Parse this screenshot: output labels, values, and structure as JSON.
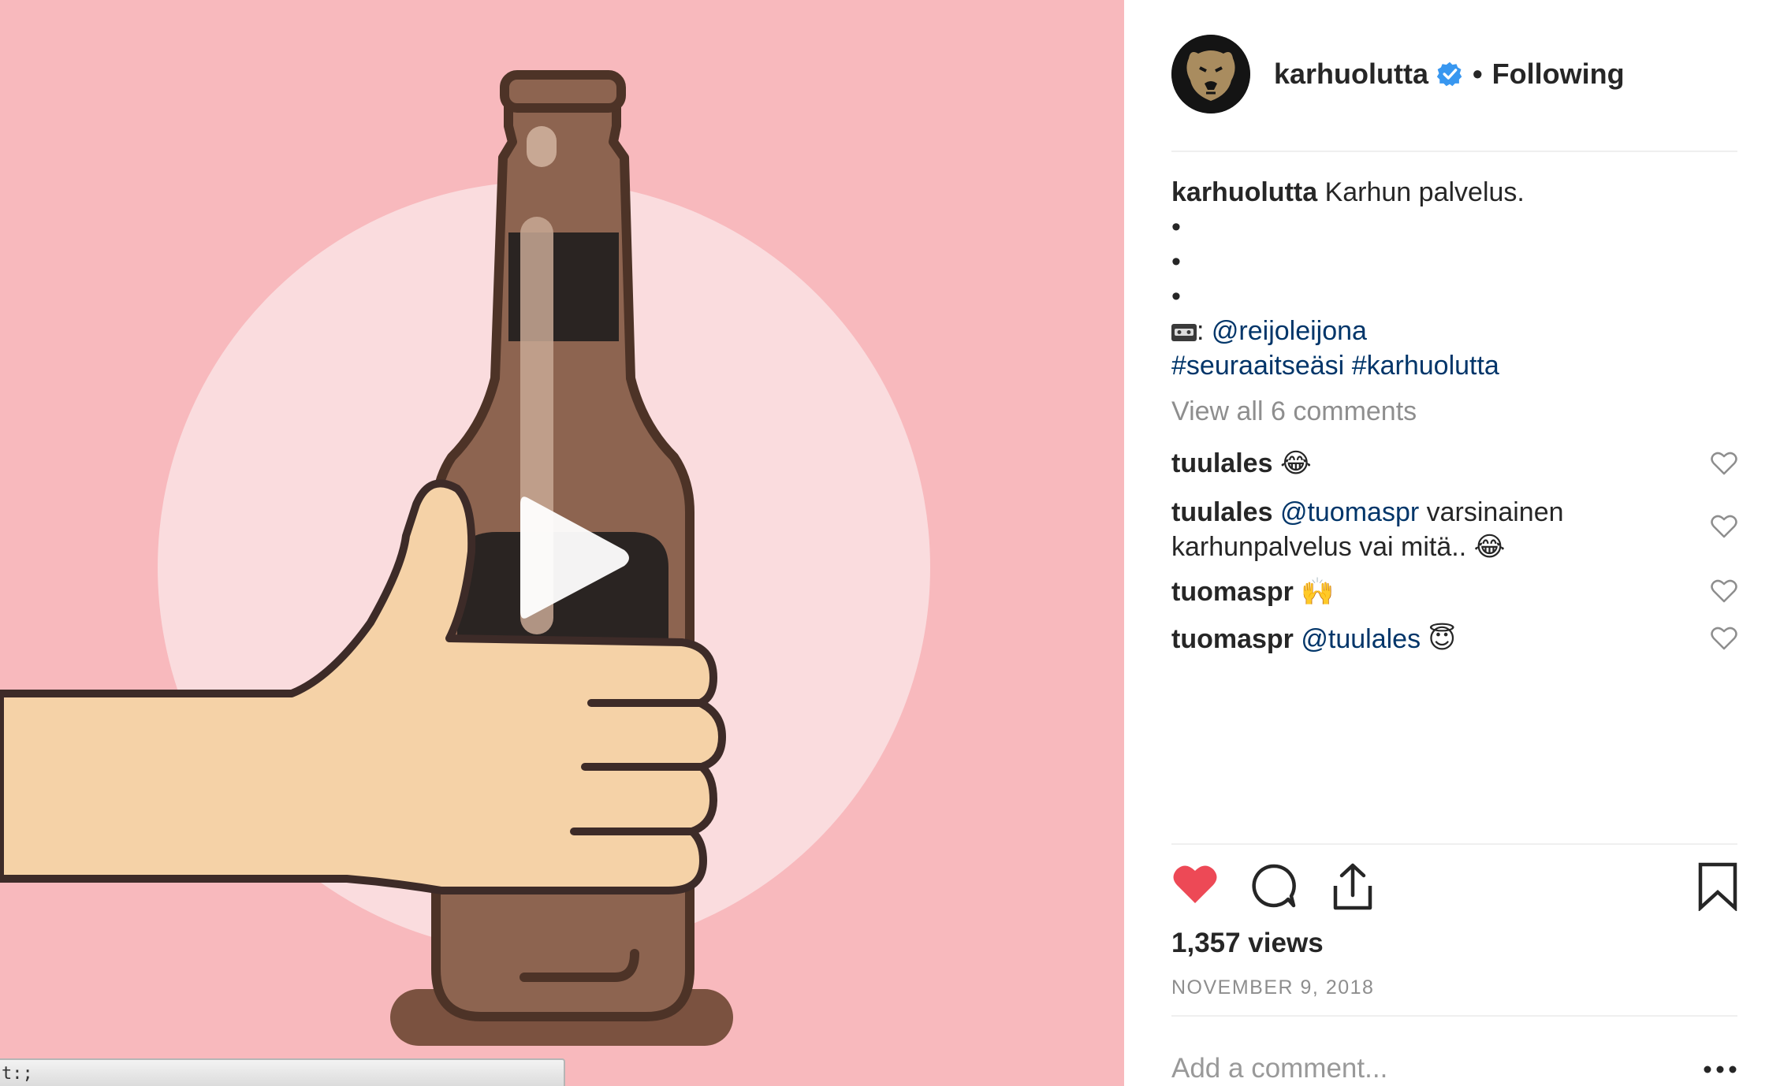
{
  "colors": {
    "media_background": "#f8b9bd",
    "link": "#003569",
    "like_red": "#ed4956",
    "verified_blue": "#3897f0",
    "muted_gray": "#8e8e8e"
  },
  "media": {
    "type": "video",
    "play_icon": "play-icon",
    "status_bar_text": "t:;"
  },
  "header": {
    "avatar_icon": "bear-logo-icon",
    "username": "karhuolutta",
    "verified_icon": "verified-badge-icon",
    "separator": "•",
    "follow_status": "Following"
  },
  "caption": {
    "username": "karhuolutta",
    "text": "Karhun palvelus.",
    "bullets": [
      "•",
      "•",
      "•"
    ],
    "credit_icon": "videotape-emoji",
    "credit_separator": ": ",
    "credit_mention": "@reijoleijona",
    "hashtags": [
      "#seuraaitseäsi",
      "#karhuolutta"
    ]
  },
  "view_all_comments": "View all 6 comments",
  "comments": [
    {
      "username": "tuulales",
      "mention": "",
      "text": "",
      "emoji": "😂",
      "heart_icon": "heart-outline-icon"
    },
    {
      "username": "tuulales",
      "mention": "@tuomaspr",
      "text": "varsinainen karhunpalvelus vai mitä..",
      "emoji": "😂",
      "heart_icon": "heart-outline-icon"
    },
    {
      "username": "tuomaspr",
      "mention": "",
      "text": "",
      "emoji": "🙌",
      "heart_icon": "heart-outline-icon"
    },
    {
      "username": "tuomaspr",
      "mention": "@tuulales",
      "text": "",
      "emoji": "😇",
      "heart_icon": "heart-outline-icon"
    }
  ],
  "actions": {
    "like_icon": "heart-filled-icon",
    "liked": true,
    "comment_icon": "comment-bubble-icon",
    "share_icon": "share-icon",
    "save_icon": "bookmark-icon"
  },
  "views": "1,357 views",
  "date": "NOVEMBER 9, 2018",
  "add_comment": {
    "placeholder": "Add a comment...",
    "value": "",
    "more_icon": "more-options-icon"
  }
}
